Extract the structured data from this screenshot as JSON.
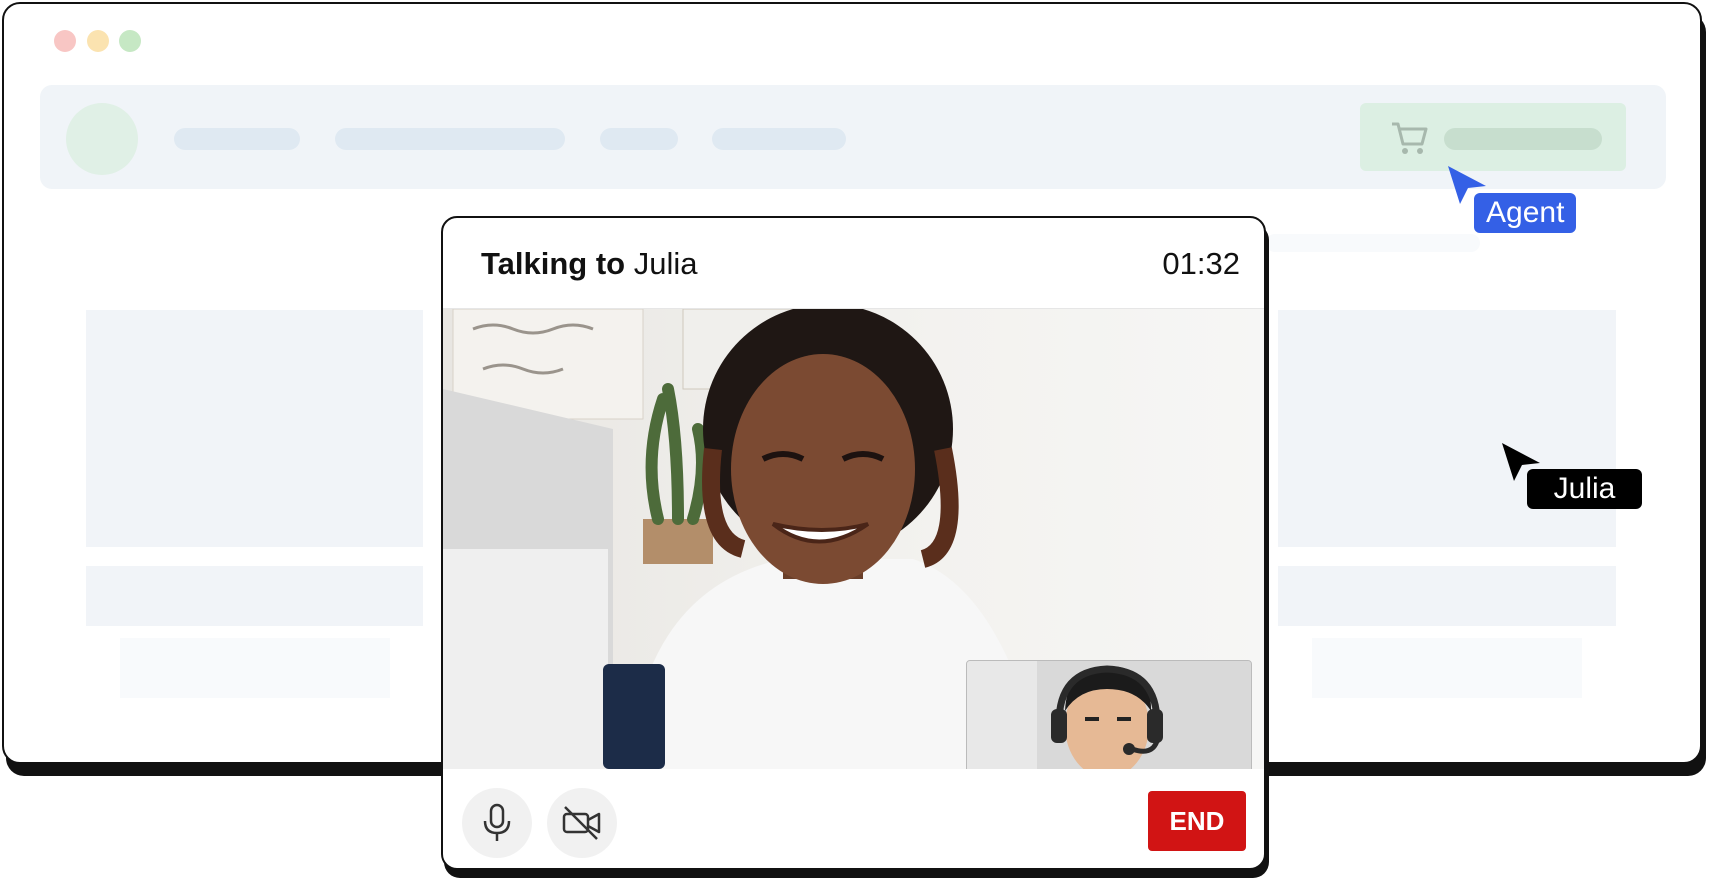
{
  "window": {
    "traffic_lights": [
      "#f8c6c4",
      "#fbe3b0",
      "#c6e8c4"
    ]
  },
  "header": {
    "cart_icon": "shopping-cart-icon"
  },
  "cursors": {
    "agent": {
      "label": "Agent",
      "color": "#3460e6"
    },
    "customer": {
      "label": "Julia",
      "color": "#000000"
    }
  },
  "call": {
    "title_prefix": "Talking to",
    "caller_name": "Julia",
    "timer": "01:32",
    "mic_icon": "microphone-icon",
    "camera_icon": "camera-off-icon",
    "end_label": "END",
    "end_color": "#d11414"
  }
}
